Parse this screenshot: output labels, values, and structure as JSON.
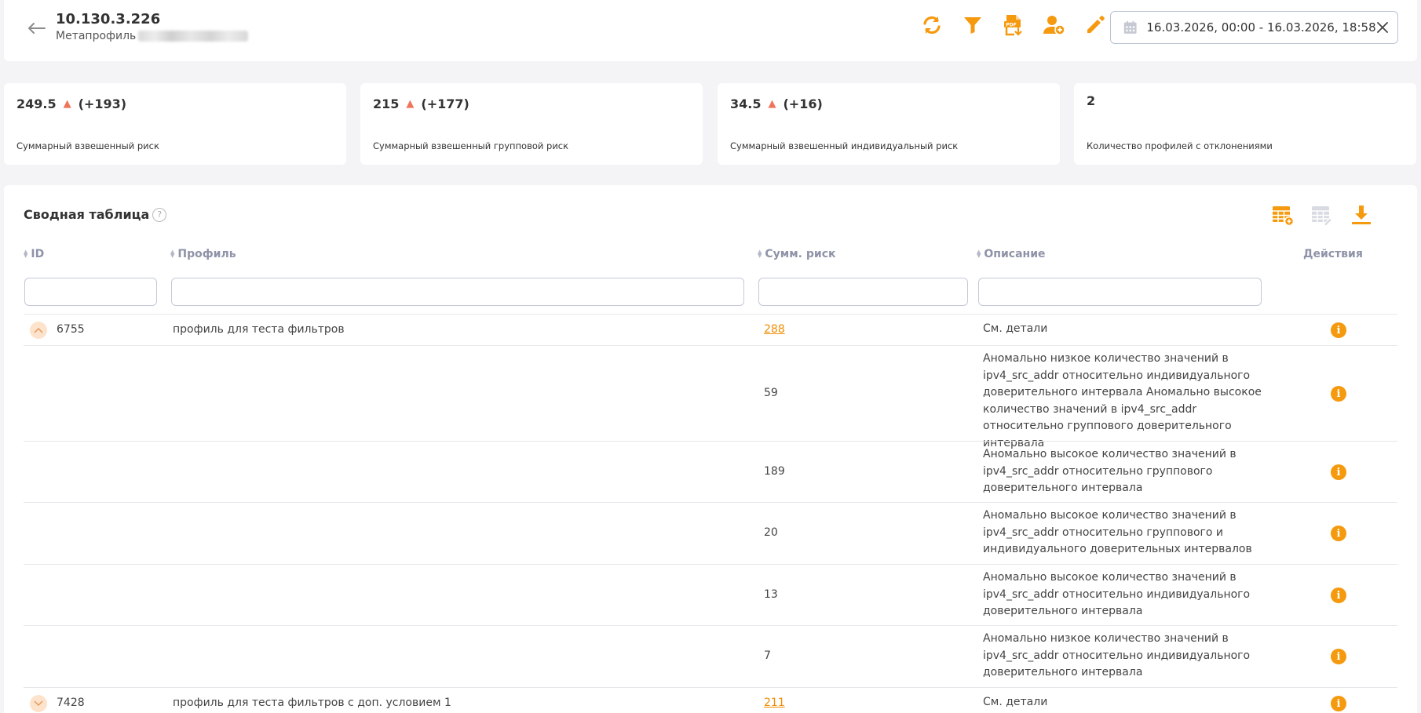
{
  "colors": {
    "accent": "#f59a0f",
    "trend_up": "#f0735a",
    "link": "#f08c00"
  },
  "header": {
    "title": "10.130.3.226",
    "metaprofile_label": "Метапрофиль",
    "date_range": "16.03.2026, 00:00 - 16.03.2026, 18:58",
    "icons": [
      "back-arrow-icon",
      "refresh-icon",
      "filter-icon",
      "pdf-export-icon",
      "user-add-icon",
      "edit-icon",
      "calendar-icon",
      "close-icon"
    ]
  },
  "cards": [
    {
      "value": "249.5",
      "delta": "(+193)",
      "trend": "up",
      "label": "Суммарный взвешенный риск"
    },
    {
      "value": "215",
      "delta": "(+177)",
      "trend": "up",
      "label": "Суммарный взвешенный групповой риск"
    },
    {
      "value": "34.5",
      "delta": "(+16)",
      "trend": "up",
      "label": "Суммарный взвешенный индивидуальный риск"
    },
    {
      "value": "2",
      "delta": "",
      "trend": "",
      "label": "Количество профилей с отклонениями"
    }
  ],
  "table": {
    "title": "Сводная таблица",
    "help": "?",
    "tools": [
      "table-add-icon",
      "table-edit-icon",
      "download-icon"
    ],
    "columns": {
      "id": "ID",
      "profile": "Профиль",
      "sum_risk": "Сумм. риск",
      "description": "Описание",
      "actions": "Действия"
    },
    "rows": [
      {
        "id": "6755",
        "profile": "профиль для теста фильтров",
        "sum_risk": "288",
        "description": "См. детали",
        "expanded": true
      },
      {
        "id": "",
        "profile": "",
        "sum_risk": "59",
        "description": "Аномально низкое количество значений в ipv4_src_addr относительно индивидуального доверительного интервала Аномально высокое количество значений в ipv4_src_addr относительно группового доверительного интервала"
      },
      {
        "id": "",
        "profile": "",
        "sum_risk": "189",
        "description": "Аномально высокое количество значений в ipv4_src_addr относительно группового доверительного интервала"
      },
      {
        "id": "",
        "profile": "",
        "sum_risk": "20",
        "description": "Аномально высокое количество значений в ipv4_src_addr относительно группового и индивидуального доверительных интервалов"
      },
      {
        "id": "",
        "profile": "",
        "sum_risk": "13",
        "description": "Аномально высокое количество значений в ipv4_src_addr относительно индивидуального доверительного интервала"
      },
      {
        "id": "",
        "profile": "",
        "sum_risk": "7",
        "description": "Аномально низкое количество значений в ipv4_src_addr относительно индивидуального доверительного интервала"
      },
      {
        "id": "7428",
        "profile": "профиль для теста фильтров с доп. условием 1",
        "sum_risk": "211",
        "description": "См. детали",
        "expanded": false
      }
    ]
  }
}
